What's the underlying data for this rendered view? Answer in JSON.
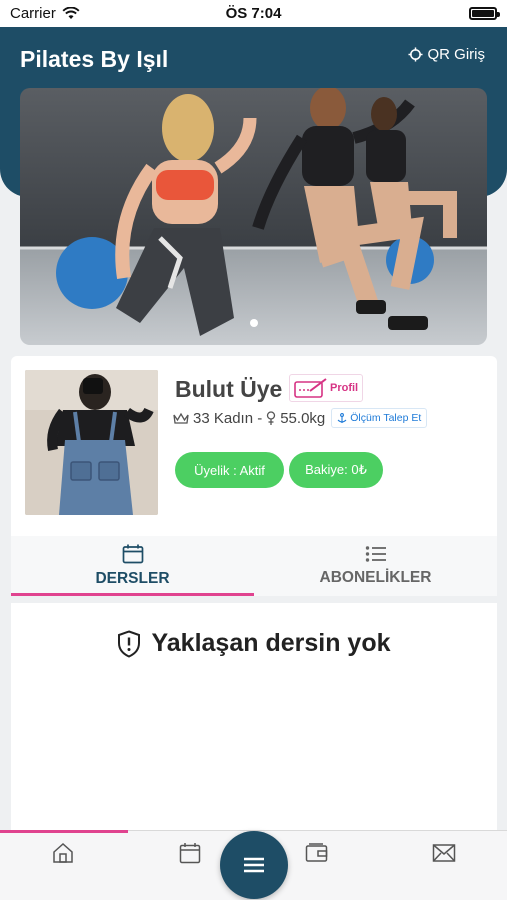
{
  "status_bar": {
    "carrier": "Carrier",
    "time": "ÖS 7:04"
  },
  "header": {
    "title": "Pilates By Işıl",
    "qr_label": "QR Giriş"
  },
  "hero": {
    "slide_count": 1,
    "active_slide": 0
  },
  "member": {
    "name": "Bulut Üye",
    "profile_label": "Profil",
    "age_gender": "33 Kadın -",
    "weight": "55.0kg",
    "measure_request_label": "Ölçüm Talep Et",
    "membership_status": "Üyelik : Aktif",
    "balance": "Bakiye: 0₺"
  },
  "tabs": [
    {
      "label": "DERSLER",
      "icon": "calendar-icon",
      "active": true
    },
    {
      "label": "ABONELİKLER",
      "icon": "list-icon",
      "active": false
    }
  ],
  "lessons": {
    "empty_message": "Yaklaşan dersin yok"
  },
  "bottom_nav": {
    "items": [
      "home-icon",
      "calendar-icon",
      "menu-icon",
      "wallet-icon",
      "mail-icon"
    ]
  },
  "colors": {
    "primary": "#1e4d66",
    "accent": "#e0438f",
    "success": "#4ccf62",
    "link": "#1f7bd8"
  }
}
